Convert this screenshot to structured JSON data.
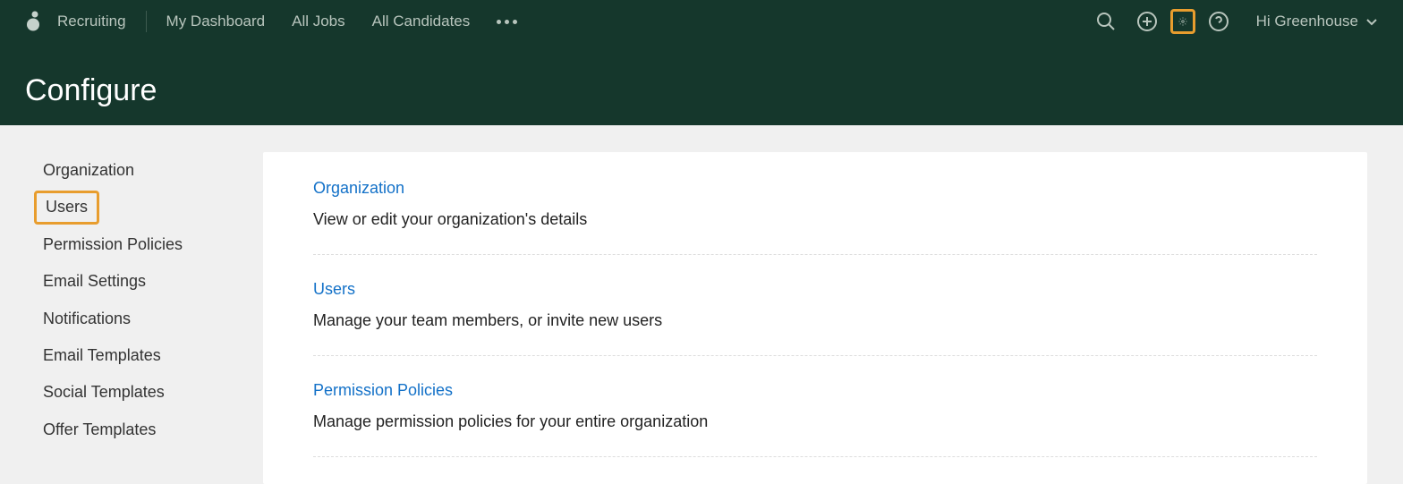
{
  "topnav": {
    "brand": "Recruiting",
    "items": [
      "My Dashboard",
      "All Jobs",
      "All Candidates"
    ],
    "greeting": "Hi Greenhouse"
  },
  "page": {
    "title": "Configure"
  },
  "sidebar": {
    "items": [
      {
        "label": "Organization",
        "highlighted": false
      },
      {
        "label": "Users",
        "highlighted": true
      },
      {
        "label": "Permission Policies",
        "highlighted": false
      },
      {
        "label": "Email Settings",
        "highlighted": false
      },
      {
        "label": "Notifications",
        "highlighted": false
      },
      {
        "label": "Email Templates",
        "highlighted": false
      },
      {
        "label": "Social Templates",
        "highlighted": false
      },
      {
        "label": "Offer Templates",
        "highlighted": false
      }
    ]
  },
  "sections": [
    {
      "title": "Organization",
      "desc": "View or edit your organization's details"
    },
    {
      "title": "Users",
      "desc": "Manage your team members, or invite new users"
    },
    {
      "title": "Permission Policies",
      "desc": "Manage permission policies for your entire organization"
    }
  ]
}
